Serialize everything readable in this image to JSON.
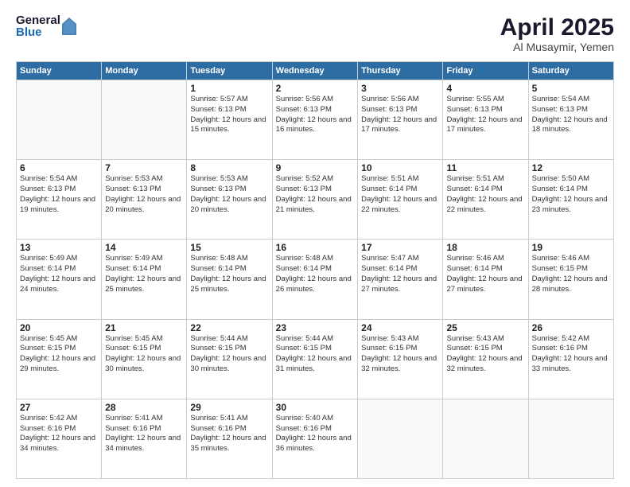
{
  "logo": {
    "general": "General",
    "blue": "Blue"
  },
  "title": "April 2025",
  "location": "Al Musaymir, Yemen",
  "days_header": [
    "Sunday",
    "Monday",
    "Tuesday",
    "Wednesday",
    "Thursday",
    "Friday",
    "Saturday"
  ],
  "weeks": [
    [
      {
        "day": "",
        "info": ""
      },
      {
        "day": "",
        "info": ""
      },
      {
        "day": "1",
        "info": "Sunrise: 5:57 AM\nSunset: 6:13 PM\nDaylight: 12 hours and 15 minutes."
      },
      {
        "day": "2",
        "info": "Sunrise: 5:56 AM\nSunset: 6:13 PM\nDaylight: 12 hours and 16 minutes."
      },
      {
        "day": "3",
        "info": "Sunrise: 5:56 AM\nSunset: 6:13 PM\nDaylight: 12 hours and 17 minutes."
      },
      {
        "day": "4",
        "info": "Sunrise: 5:55 AM\nSunset: 6:13 PM\nDaylight: 12 hours and 17 minutes."
      },
      {
        "day": "5",
        "info": "Sunrise: 5:54 AM\nSunset: 6:13 PM\nDaylight: 12 hours and 18 minutes."
      }
    ],
    [
      {
        "day": "6",
        "info": "Sunrise: 5:54 AM\nSunset: 6:13 PM\nDaylight: 12 hours and 19 minutes."
      },
      {
        "day": "7",
        "info": "Sunrise: 5:53 AM\nSunset: 6:13 PM\nDaylight: 12 hours and 20 minutes."
      },
      {
        "day": "8",
        "info": "Sunrise: 5:53 AM\nSunset: 6:13 PM\nDaylight: 12 hours and 20 minutes."
      },
      {
        "day": "9",
        "info": "Sunrise: 5:52 AM\nSunset: 6:13 PM\nDaylight: 12 hours and 21 minutes."
      },
      {
        "day": "10",
        "info": "Sunrise: 5:51 AM\nSunset: 6:14 PM\nDaylight: 12 hours and 22 minutes."
      },
      {
        "day": "11",
        "info": "Sunrise: 5:51 AM\nSunset: 6:14 PM\nDaylight: 12 hours and 22 minutes."
      },
      {
        "day": "12",
        "info": "Sunrise: 5:50 AM\nSunset: 6:14 PM\nDaylight: 12 hours and 23 minutes."
      }
    ],
    [
      {
        "day": "13",
        "info": "Sunrise: 5:49 AM\nSunset: 6:14 PM\nDaylight: 12 hours and 24 minutes."
      },
      {
        "day": "14",
        "info": "Sunrise: 5:49 AM\nSunset: 6:14 PM\nDaylight: 12 hours and 25 minutes."
      },
      {
        "day": "15",
        "info": "Sunrise: 5:48 AM\nSunset: 6:14 PM\nDaylight: 12 hours and 25 minutes."
      },
      {
        "day": "16",
        "info": "Sunrise: 5:48 AM\nSunset: 6:14 PM\nDaylight: 12 hours and 26 minutes."
      },
      {
        "day": "17",
        "info": "Sunrise: 5:47 AM\nSunset: 6:14 PM\nDaylight: 12 hours and 27 minutes."
      },
      {
        "day": "18",
        "info": "Sunrise: 5:46 AM\nSunset: 6:14 PM\nDaylight: 12 hours and 27 minutes."
      },
      {
        "day": "19",
        "info": "Sunrise: 5:46 AM\nSunset: 6:15 PM\nDaylight: 12 hours and 28 minutes."
      }
    ],
    [
      {
        "day": "20",
        "info": "Sunrise: 5:45 AM\nSunset: 6:15 PM\nDaylight: 12 hours and 29 minutes."
      },
      {
        "day": "21",
        "info": "Sunrise: 5:45 AM\nSunset: 6:15 PM\nDaylight: 12 hours and 30 minutes."
      },
      {
        "day": "22",
        "info": "Sunrise: 5:44 AM\nSunset: 6:15 PM\nDaylight: 12 hours and 30 minutes."
      },
      {
        "day": "23",
        "info": "Sunrise: 5:44 AM\nSunset: 6:15 PM\nDaylight: 12 hours and 31 minutes."
      },
      {
        "day": "24",
        "info": "Sunrise: 5:43 AM\nSunset: 6:15 PM\nDaylight: 12 hours and 32 minutes."
      },
      {
        "day": "25",
        "info": "Sunrise: 5:43 AM\nSunset: 6:15 PM\nDaylight: 12 hours and 32 minutes."
      },
      {
        "day": "26",
        "info": "Sunrise: 5:42 AM\nSunset: 6:16 PM\nDaylight: 12 hours and 33 minutes."
      }
    ],
    [
      {
        "day": "27",
        "info": "Sunrise: 5:42 AM\nSunset: 6:16 PM\nDaylight: 12 hours and 34 minutes."
      },
      {
        "day": "28",
        "info": "Sunrise: 5:41 AM\nSunset: 6:16 PM\nDaylight: 12 hours and 34 minutes."
      },
      {
        "day": "29",
        "info": "Sunrise: 5:41 AM\nSunset: 6:16 PM\nDaylight: 12 hours and 35 minutes."
      },
      {
        "day": "30",
        "info": "Sunrise: 5:40 AM\nSunset: 6:16 PM\nDaylight: 12 hours and 36 minutes."
      },
      {
        "day": "",
        "info": ""
      },
      {
        "day": "",
        "info": ""
      },
      {
        "day": "",
        "info": ""
      }
    ]
  ]
}
